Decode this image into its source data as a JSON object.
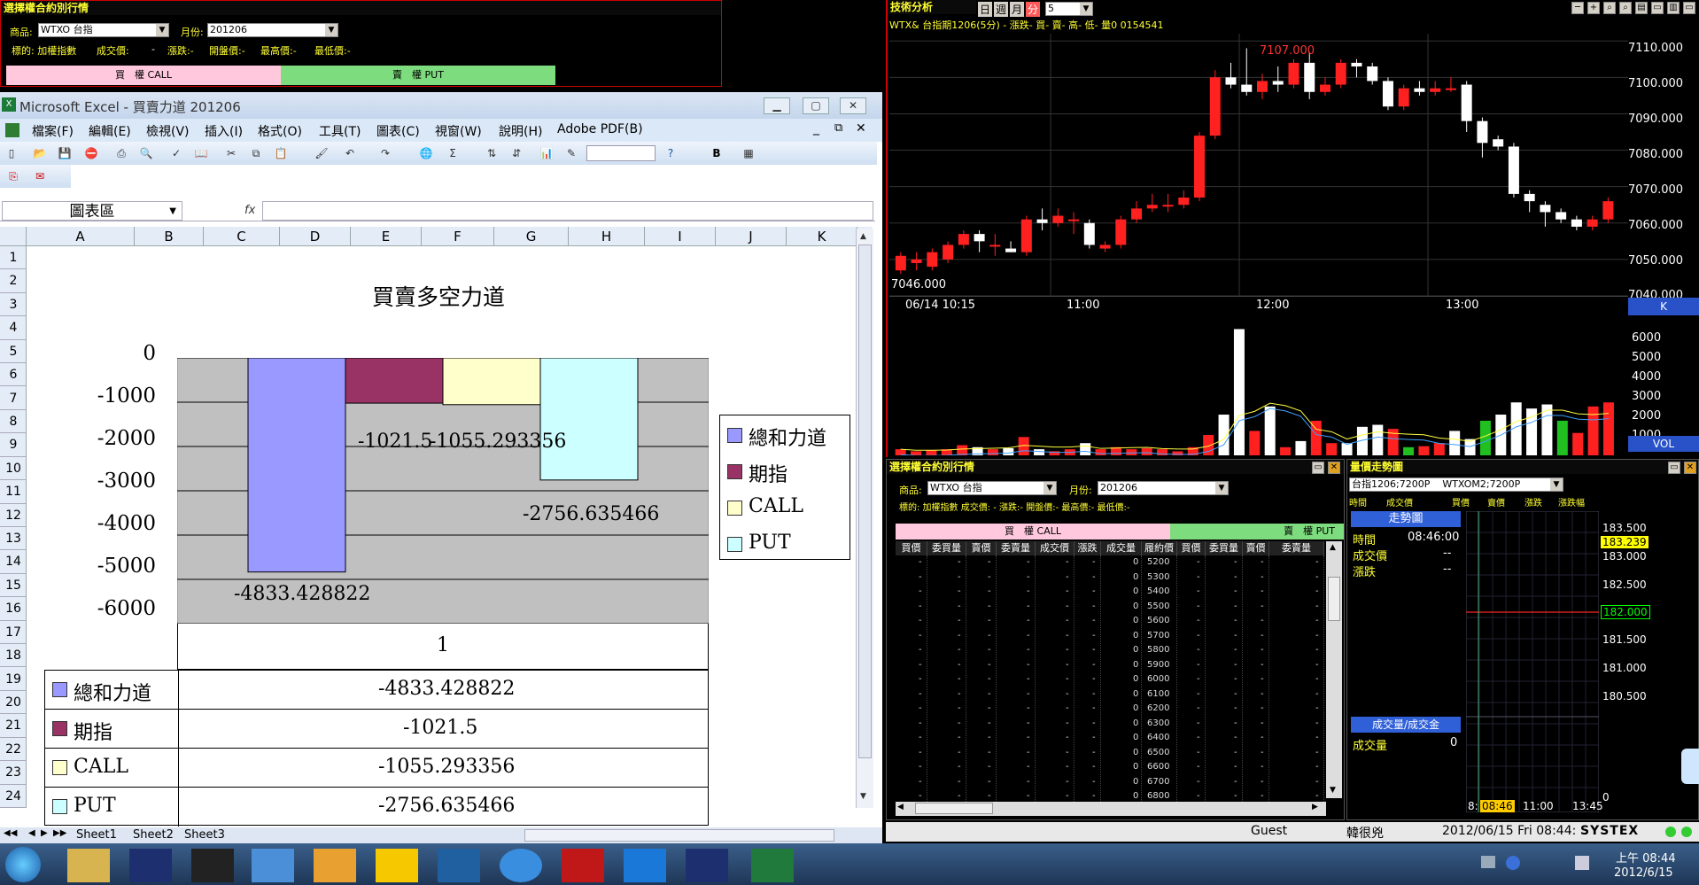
{
  "top_quote": {
    "title": "選擇權合約別行情",
    "product_label": "商品:",
    "product_value": "WTXO 台指",
    "month_label": "月份:",
    "month_value": "201206",
    "info": [
      "標的: 加權指數",
      "成交價:",
      "-",
      "漲跌:-",
      "開盤價:-",
      "最高價:-",
      "最低價:-"
    ],
    "call_label": "買　權 CALL",
    "put_label": "賣　權 PUT"
  },
  "excel": {
    "window_title": "Microsoft Excel - 買賣力道 201206",
    "menu": [
      "檔案(F)",
      "編輯(E)",
      "檢視(V)",
      "插入(I)",
      "格式(O)",
      "工具(T)",
      "圖表(C)",
      "視窗(W)",
      "說明(H)",
      "Adobe PDF(B)"
    ],
    "name_box": "圖表區",
    "fx": "fx",
    "bold": "B",
    "columns": [
      "A",
      "B",
      "C",
      "D",
      "E",
      "F",
      "G",
      "H",
      "I",
      "J",
      "K"
    ],
    "rows": [
      "1",
      "2",
      "3",
      "4",
      "5",
      "6",
      "7",
      "8",
      "9",
      "10",
      "11",
      "12",
      "13",
      "14",
      "15",
      "16",
      "17",
      "18",
      "19",
      "20",
      "21",
      "22",
      "23",
      "24"
    ],
    "sheets": [
      "Sheet1",
      "Sheet2",
      "Sheet3"
    ]
  },
  "chart_data": {
    "type": "bar",
    "title": "買賣多空力道",
    "categories": [
      "1"
    ],
    "series": [
      {
        "name": "總和力道",
        "values": [
          -4833.428822
        ],
        "color": "#9999ff",
        "label": "-4833.428822"
      },
      {
        "name": "期指",
        "values": [
          -1021.5
        ],
        "color": "#993366",
        "label": "-1021.5"
      },
      {
        "name": "CALL",
        "values": [
          -1055.293356
        ],
        "color": "#ffffcc",
        "label": "-1055.293356"
      },
      {
        "name": "PUT",
        "values": [
          -2756.635466
        ],
        "color": "#ccffff",
        "label": "-2756.635466"
      }
    ],
    "y_ticks": [
      "0",
      "-1000",
      "-2000",
      "-3000",
      "-4000",
      "-5000",
      "-6000"
    ],
    "ylim": [
      -6000,
      0
    ],
    "grid": true,
    "legend": "right",
    "data_table": true
  },
  "tech": {
    "title": "技術分析",
    "periods": [
      "日",
      "週",
      "月",
      "分"
    ],
    "interval": "5",
    "info": "WTX& 台指期1206(5分)  -  漲跌-  買-  賣-  高-  低-  量0  0154541",
    "high_mark": "7107.000",
    "low_mark": "7046.000",
    "price_ticks": [
      "7110.000",
      "7100.000",
      "7090.000",
      "7080.000",
      "7070.000",
      "7060.000",
      "7050.000",
      "7040.000"
    ],
    "time_ticks": [
      "06/14 10:15",
      "11:00",
      "12:00",
      "13:00"
    ],
    "k_label": "K",
    "vol_ticks": [
      "6000",
      "5000",
      "4000",
      "3000",
      "2000",
      "1000"
    ],
    "vol_label": "VOL",
    "candles": [
      [
        7047,
        7051,
        7046,
        7052
      ],
      [
        7049,
        7050,
        7047,
        7052
      ],
      [
        7048,
        7052,
        7047,
        7053
      ],
      [
        7050,
        7054,
        7049,
        7055
      ],
      [
        7054,
        7057,
        7053,
        7058
      ],
      [
        7057,
        7055,
        7052,
        7058
      ],
      [
        7054,
        7054,
        7051,
        7057
      ],
      [
        7053,
        7052,
        7052,
        7055
      ],
      [
        7052,
        7061,
        7051,
        7062
      ],
      [
        7061,
        7060,
        7058,
        7064
      ],
      [
        7060,
        7062,
        7059,
        7064
      ],
      [
        7061,
        7061,
        7057,
        7063
      ],
      [
        7060,
        7054,
        7053,
        7061
      ],
      [
        7053,
        7054,
        7052,
        7055
      ],
      [
        7054,
        7061,
        7053,
        7062
      ],
      [
        7061,
        7064,
        7060,
        7066
      ],
      [
        7064,
        7065,
        7063,
        7068
      ],
      [
        7065,
        7065,
        7063,
        7068
      ],
      [
        7065,
        7067,
        7064,
        7069
      ],
      [
        7067,
        7084,
        7066,
        7085
      ],
      [
        7084,
        7100,
        7083,
        7102
      ],
      [
        7100,
        7098,
        7097,
        7104
      ],
      [
        7098,
        7096,
        7095,
        7108
      ],
      [
        7096,
        7099,
        7094,
        7101
      ],
      [
        7099,
        7098,
        7096,
        7103
      ],
      [
        7098,
        7104,
        7097,
        7105
      ],
      [
        7104,
        7096,
        7094,
        7107
      ],
      [
        7096,
        7098,
        7095,
        7100
      ],
      [
        7098,
        7104,
        7097,
        7105
      ],
      [
        7104,
        7103,
        7100,
        7105
      ],
      [
        7103,
        7099,
        7098,
        7104
      ],
      [
        7099,
        7092,
        7091,
        7100
      ],
      [
        7092,
        7097,
        7091,
        7098
      ],
      [
        7097,
        7096,
        7095,
        7099
      ],
      [
        7096,
        7097,
        7095,
        7099
      ],
      [
        7097,
        7097,
        7096,
        7100
      ],
      [
        7098,
        7088,
        7085,
        7099
      ],
      [
        7088,
        7082,
        7078,
        7089
      ],
      [
        7083,
        7081,
        7080,
        7084
      ],
      [
        7081,
        7068,
        7067,
        7082
      ],
      [
        7068,
        7066,
        7063,
        7069
      ],
      [
        7065,
        7063,
        7059,
        7066
      ],
      [
        7063,
        7061,
        7060,
        7064
      ],
      [
        7061,
        7059,
        7058,
        7062
      ],
      [
        7059,
        7061,
        7058,
        7062
      ],
      [
        7061,
        7066,
        7060,
        7067
      ]
    ],
    "volumes": [
      300,
      200,
      250,
      300,
      500,
      400,
      300,
      350,
      900,
      300,
      200,
      300,
      600,
      300,
      400,
      300,
      350,
      300,
      200,
      400,
      1000,
      2000,
      6200,
      1200,
      2400,
      400,
      700,
      1700,
      600,
      600,
      1400,
      1500,
      1300,
      400,
      450,
      600,
      1200,
      800,
      1700,
      2000,
      2600,
      2300,
      2500,
      1700,
      1100,
      2400,
      2600
    ]
  },
  "bottom_quote": {
    "title": "選擇權合約別行情",
    "product_label": "商品:",
    "product_value": "WTXO 台指",
    "month_label": "月份:",
    "month_value": "201206",
    "info": "標的: 加權指數  成交價:  -  漲跌:-  開盤價:-  最高價:-  最低價:-",
    "call_label": "買　權 CALL",
    "put_label": "賣　權 PUT",
    "headers": [
      "買價",
      "委買量",
      "賣價",
      "委賣量",
      "成交價",
      "漲跌",
      "成交量",
      "履約價",
      "買價",
      "委買量",
      "賣價",
      "委賣量"
    ],
    "strikes": [
      "5200",
      "5300",
      "5400",
      "5500",
      "5600",
      "5700",
      "5800",
      "5900",
      "6000",
      "6100",
      "6200",
      "6300",
      "6400",
      "6500",
      "6600",
      "6700",
      "6800"
    ],
    "dash": "-",
    "zero": "0"
  },
  "price_trend": {
    "title": "量價走勢圖",
    "combo1": "台指1206;7200P",
    "combo2": "WTXOM2;7200P",
    "header": [
      "時間",
      "成交價",
      "買價",
      "賣價",
      "漲跌",
      "漲跌幅"
    ],
    "trend_label": "走勢圖",
    "time_label": "時間",
    "time_value": "08:46:00",
    "price_label": "成交價",
    "change_label": "漲跌",
    "dashes": "--",
    "vol_section": "成交量/成交金",
    "vol_label": "成交量",
    "vol_value": "0",
    "y_ticks": [
      "183.500",
      "183.000",
      "182.500",
      "182.000",
      "181.500",
      "181.000",
      "180.500"
    ],
    "current_price": "183.239",
    "green_price": "182.000",
    "x_ticks": [
      "8:",
      "08:46",
      "11:00",
      "13:45"
    ],
    "zero": "0"
  },
  "status": {
    "user": "Guest",
    "name": "韓很兇",
    "datetime": "2012/06/15 Fri 08:44:",
    "brand": "SYSTEX"
  },
  "taskbar": {
    "clock_time": "上午 08:44",
    "clock_date": "2012/6/15"
  }
}
